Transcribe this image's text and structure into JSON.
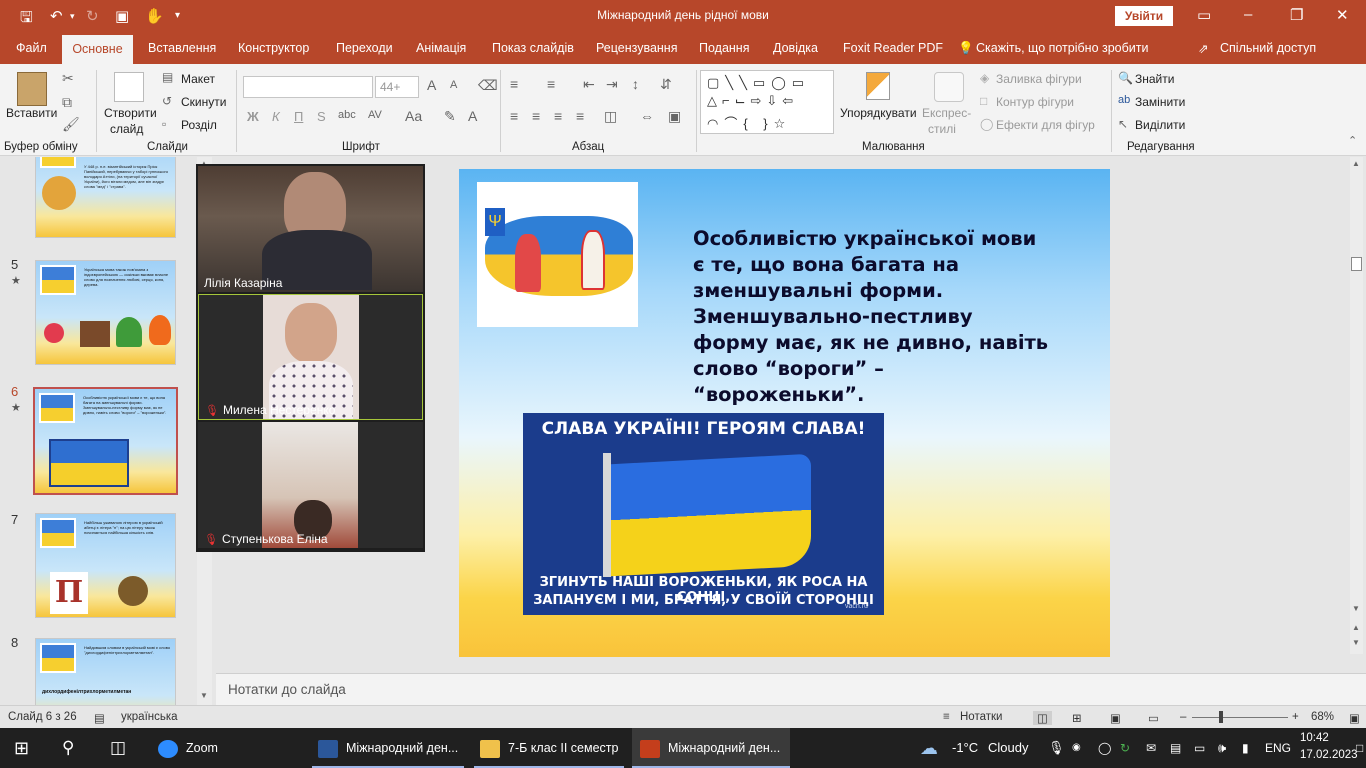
{
  "titlebar": {
    "doc_title": "Міжнародний день рідної мови",
    "signin": "Увійти"
  },
  "tabs": {
    "file": "Файл",
    "home": "Основне",
    "insert": "Вставлення",
    "design": "Конструктор",
    "transitions": "Переходи",
    "animation": "Анімація",
    "slideshow": "Показ слайдів",
    "review": "Рецензування",
    "view": "Подання",
    "help": "Довідка",
    "foxit": "Foxit Reader PDF",
    "tellme": "Скажіть, що потрібно зробити",
    "share": "Спільний доступ"
  },
  "ribbon": {
    "paste": "Вставити",
    "clipboard": "Буфер обміну",
    "new_slide_1": "Створити",
    "new_slide_2": "слайд",
    "layout": "Макет",
    "reset": "Скинути",
    "section": "Розділ",
    "slides": "Слайди",
    "font_size": "44+",
    "font_group": "Шрифт",
    "bold": "Ж",
    "italic": "К",
    "underline": "П",
    "strike": "S",
    "paragraph": "Абзац",
    "arrange": "Упорядкувати",
    "quick_styles_1": "Експрес-",
    "quick_styles_2": "стилі",
    "shape_fill": "Заливка фігури",
    "shape_outline": "Контур фігури",
    "shape_effects": "Ефекти для фігур",
    "drawing": "Малювання",
    "find": "Знайти",
    "replace": "Замінити",
    "select": "Виділити",
    "editing": "Редагування"
  },
  "thumbnails": [
    {
      "num": "",
      "text": "У 448 р. н.е. візантійський історик Пріск Панійський, перебуваючи у таборі гуннського володаря Аттіли, (на території сучасної України), його вітали медом, але він згадує слова \"мед\" і \"страва\"."
    },
    {
      "num": "5",
      "text": "Українська мова також пов'язана з індоєвропейською — оскільки вживає власне слово для позначення любові, серця, коня, дерева."
    },
    {
      "num": "6",
      "text": "Особливістю української мови є те, що вона багата на зменшувальні форми. Зменшувально-пестливу форму має, як не дивно, навіть слово \"вороги\" – \"вороженьки\"."
    },
    {
      "num": "7",
      "text": "Найбільш уживаною літерою в українській абетці є літера \"п\"; на цю літеру також починається найбільша кількість слів."
    },
    {
      "num": "8",
      "text": "Найдовшим словом в українській мові є слово \"дихлордифенілтрихлорметилметан\"."
    }
  ],
  "thumb8_word": "дихлордифенілтрихлорметилметан",
  "zoom": {
    "p1": "Лілія Казаріна",
    "p2": "Милена Нестеренко",
    "p3": "Ступенькова Еліна"
  },
  "slide": {
    "text": "Особливістю української мови є те, що вона багата на зменшувальні форми. Зменшувально-пестливу форму має, як не дивно, навіть слово “вороги” – “вороженьки”.",
    "poster_top": "СЛАВА УКРАЇНІ! ГЕРОЯМ СЛАВА!",
    "poster_bottom_1": "ЗГИНУТЬ НАШІ ВОРОЖЕНЬКИ, ЯК РОСА НА СОНЦІ,",
    "poster_bottom_2": "ЗАПАНУЄМ І МИ, БРАТТЯ, У СВОЇЙ СТОРОНЦІ",
    "poster_watermark": "vach.ru"
  },
  "notes_placeholder": "Нотатки до слайда",
  "status": {
    "slide_of": "Слайд 6 з 26",
    "language": "українська",
    "notes": "Нотатки",
    "zoom": "68%"
  },
  "taskbar": {
    "zoom_app": "Zoom",
    "word": "Міжнародний ден...",
    "folder": "7-Б клас ІІ семестр",
    "ppt": "Міжнародний ден...",
    "weather_temp": "-1°C",
    "weather_desc": "Cloudy",
    "lang": "ENG",
    "time": "10:42",
    "date": "17.02.2023"
  },
  "colors": {
    "accent": "#b7472a",
    "taskbar": "#202020",
    "ribbon": "#f3f3f3"
  }
}
